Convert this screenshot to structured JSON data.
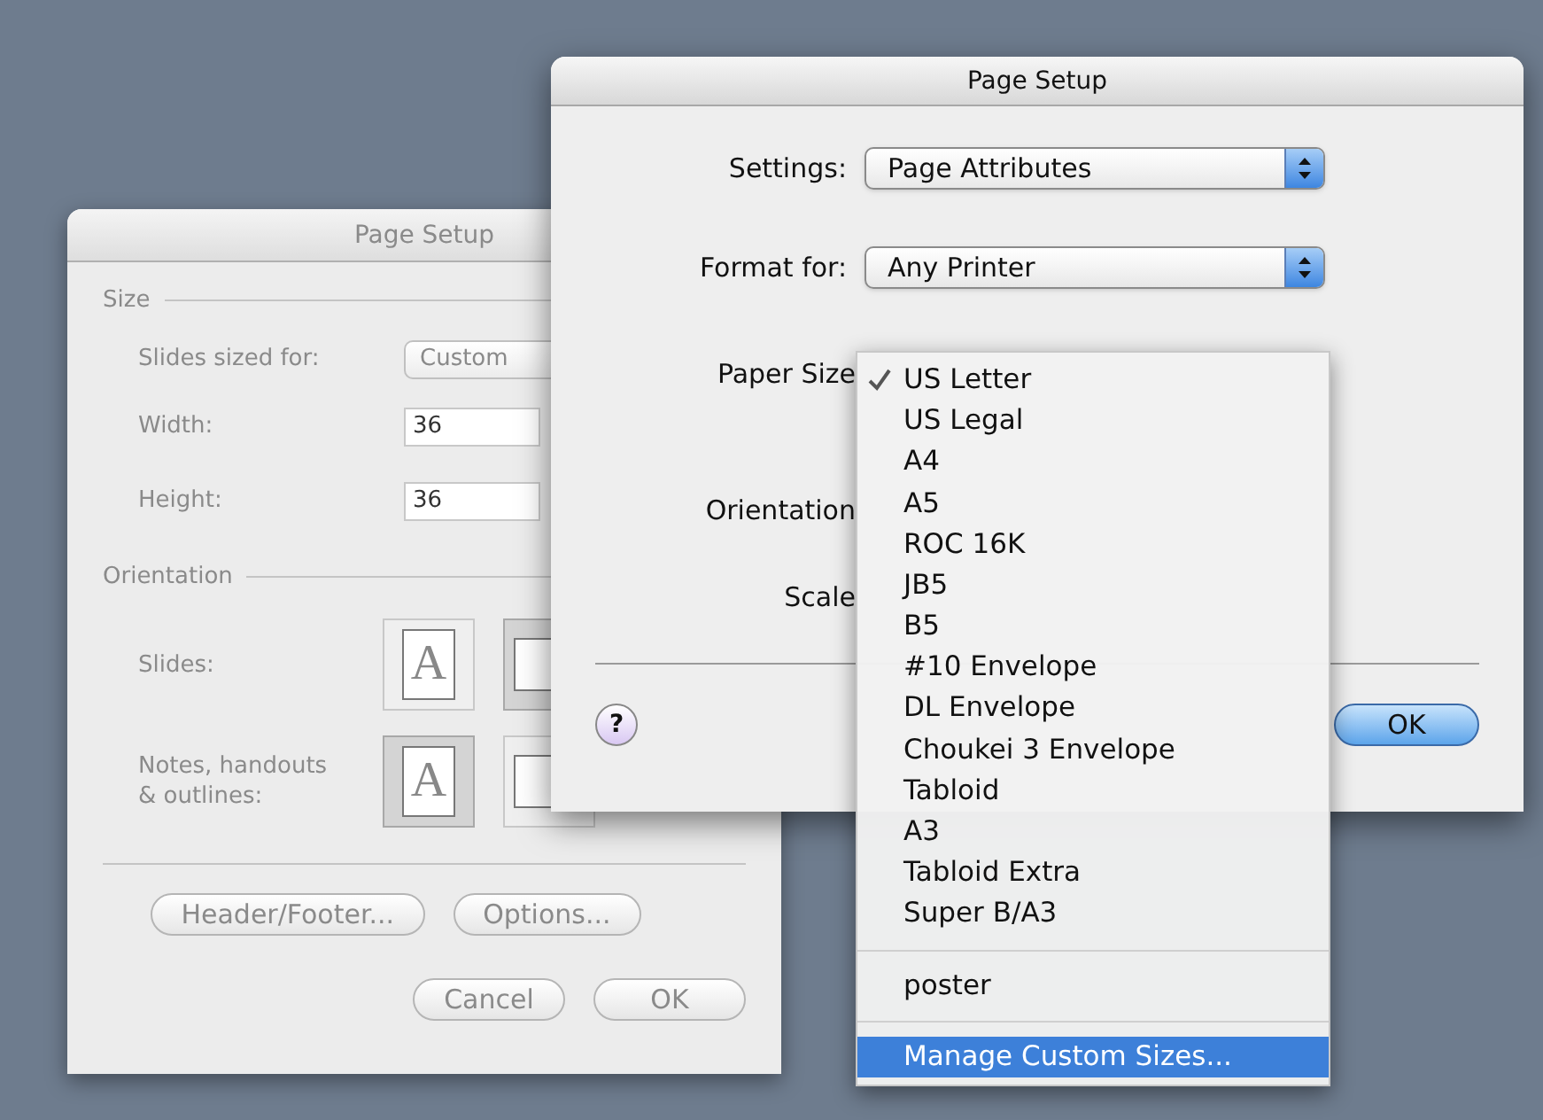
{
  "back_window": {
    "title": "Page Setup",
    "size_section": "Size",
    "slides_sized_label": "Slides sized for:",
    "slides_sized_value": "Custom",
    "width_label": "Width:",
    "width_value": "36",
    "height_label": "Height:",
    "height_value": "36",
    "orientation_section": "Orientation",
    "orientation_rows": [
      {
        "label": "Slides:",
        "options": [
          {
            "kind": "portrait",
            "glyph": "A",
            "selected": false
          },
          {
            "kind": "landscape",
            "selected": true
          }
        ]
      },
      {
        "label": "Notes, handouts\n& outlines:",
        "options": [
          {
            "kind": "portrait",
            "glyph": "A",
            "selected": true
          },
          {
            "kind": "landscape",
            "selected": false
          }
        ]
      }
    ],
    "header_footer_button": "Header/Footer...",
    "options_button": "Options...",
    "cancel_button": "Cancel",
    "ok_button": "OK"
  },
  "front_dialog": {
    "title": "Page Setup",
    "settings_label": "Settings:",
    "settings_value": "Page Attributes",
    "format_label": "Format for:",
    "format_value": "Any Printer",
    "paper_size_label": "Paper Size",
    "orientation_label": "Orientation",
    "scale_label": "Scale",
    "help_button": "?",
    "ok_button": "OK"
  },
  "paper_menu": [
    {
      "kind": "item",
      "label": "US Letter",
      "checked": true,
      "selected": false
    },
    {
      "kind": "item",
      "label": "US Legal",
      "checked": false,
      "selected": false
    },
    {
      "kind": "item",
      "label": "A4",
      "checked": false,
      "selected": false
    },
    {
      "kind": "item",
      "label": "A5",
      "checked": false,
      "selected": false
    },
    {
      "kind": "item",
      "label": "ROC 16K",
      "checked": false,
      "selected": false
    },
    {
      "kind": "item",
      "label": "JB5",
      "checked": false,
      "selected": false
    },
    {
      "kind": "item",
      "label": "B5",
      "checked": false,
      "selected": false
    },
    {
      "kind": "item",
      "label": "#10 Envelope",
      "checked": false,
      "selected": false
    },
    {
      "kind": "item",
      "label": "DL Envelope",
      "checked": false,
      "selected": false
    },
    {
      "kind": "item",
      "label": "Choukei 3 Envelope",
      "checked": false,
      "selected": false
    },
    {
      "kind": "item",
      "label": "Tabloid",
      "checked": false,
      "selected": false
    },
    {
      "kind": "item",
      "label": "A3",
      "checked": false,
      "selected": false
    },
    {
      "kind": "item",
      "label": "Tabloid Extra",
      "checked": false,
      "selected": false
    },
    {
      "kind": "item",
      "label": "Super B/A3",
      "checked": false,
      "selected": false
    },
    {
      "kind": "separator"
    },
    {
      "kind": "item",
      "label": "poster",
      "checked": false,
      "selected": false
    },
    {
      "kind": "separator"
    },
    {
      "kind": "item",
      "label": "Manage Custom Sizes...",
      "checked": false,
      "selected": true
    }
  ]
}
